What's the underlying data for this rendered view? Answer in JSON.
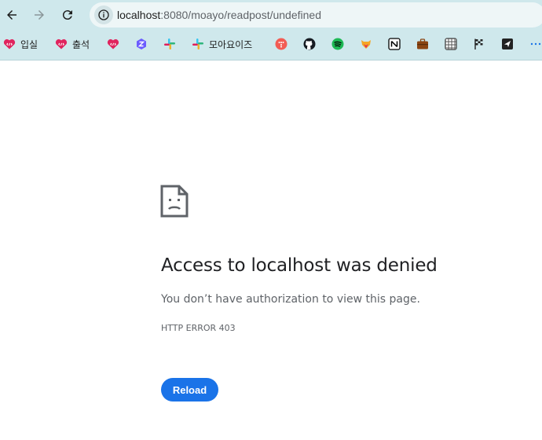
{
  "browser": {
    "url_host": "localhost",
    "url_rest": ":8080/moayo/readpost/undefined",
    "bookmarks": [
      {
        "label": "입실",
        "icon": "heart-code-icon",
        "color": "#e0245e"
      },
      {
        "label": "출석",
        "icon": "heart-code-icon",
        "color": "#e0245e"
      },
      {
        "label": "",
        "icon": "heart-code-icon",
        "color": "#e0245e"
      },
      {
        "label": "",
        "icon": "z-badge-icon",
        "color": "#6b5cff"
      },
      {
        "label": "",
        "icon": "slack-icon",
        "color": "#36c5f0"
      },
      {
        "label": "모아요이즈",
        "icon": "slack-icon",
        "color": "#ecb22e"
      },
      {
        "label": "",
        "icon": "dots-circle-icon",
        "color": "#f25c54"
      },
      {
        "label": "",
        "icon": "github-icon",
        "color": "#161b22"
      },
      {
        "label": "",
        "icon": "spotify-icon",
        "color": "#1db954"
      },
      {
        "label": "",
        "icon": "fox-icon",
        "color": "#f5a623"
      },
      {
        "label": "",
        "icon": "notion-icon",
        "color": "#000000"
      },
      {
        "label": "",
        "icon": "briefcase-icon",
        "color": "#8b4513"
      },
      {
        "label": "",
        "icon": "grid-pattern-icon",
        "color": "#555555"
      },
      {
        "label": "",
        "icon": "checkered-flag-icon",
        "color": "#222222"
      },
      {
        "label": "",
        "icon": "send-icon",
        "color": "#222222"
      },
      {
        "label": "",
        "icon": "more-icon",
        "color": "#1a73e8"
      }
    ]
  },
  "error_page": {
    "title": "Access to localhost was denied",
    "description": "You don’t have authorization to view this page.",
    "code": "HTTP ERROR 403",
    "reload_label": "Reload"
  }
}
